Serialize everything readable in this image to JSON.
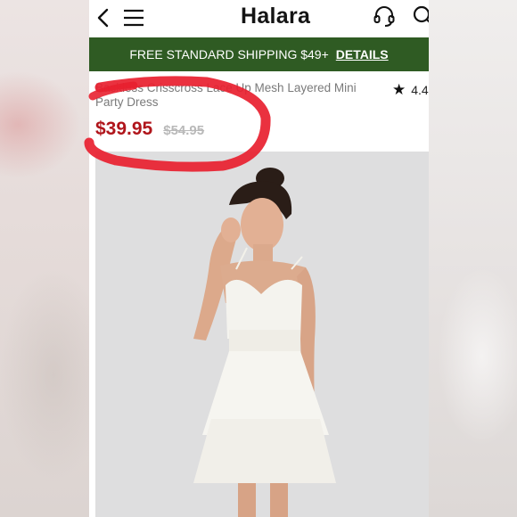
{
  "app": {
    "brand": "Halara"
  },
  "header": {
    "back_icon": "chevron-left-icon",
    "menu_icon": "hamburger-menu-icon",
    "support_icon": "headset-icon",
    "search_icon": "search-icon"
  },
  "banner": {
    "text": "FREE STANDARD SHIPPING $49+",
    "link": "DETAILS",
    "bg_color": "#2f5b23"
  },
  "product": {
    "title": "Backless Crisscross Lace Up Mesh Layered Mini Party Dress",
    "rating": "4.4",
    "price": "$39.95",
    "original_price": "$54.95",
    "price_color": "#b0151b"
  },
  "annotation": {
    "color": "#e8202f",
    "shape": "hand-drawn circle around price"
  }
}
